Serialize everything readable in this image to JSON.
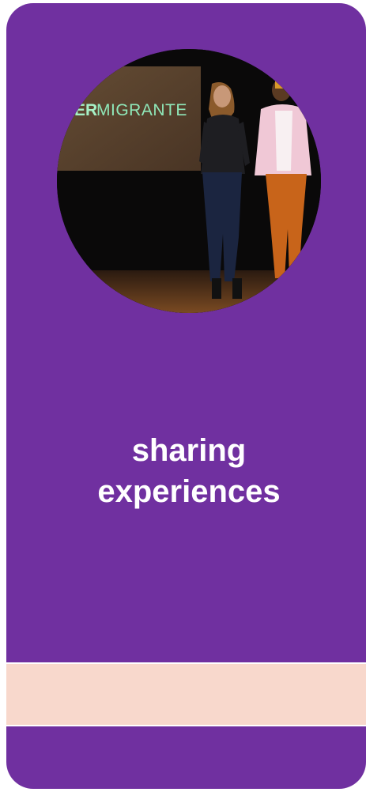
{
  "card": {
    "background_color": "#7030a0",
    "band_color": "#f8d8cc",
    "caption_line1": "sharing",
    "caption_line2": "experiences"
  },
  "photo": {
    "screen_text_bold": "ER",
    "screen_text": "MIGRANTE"
  }
}
